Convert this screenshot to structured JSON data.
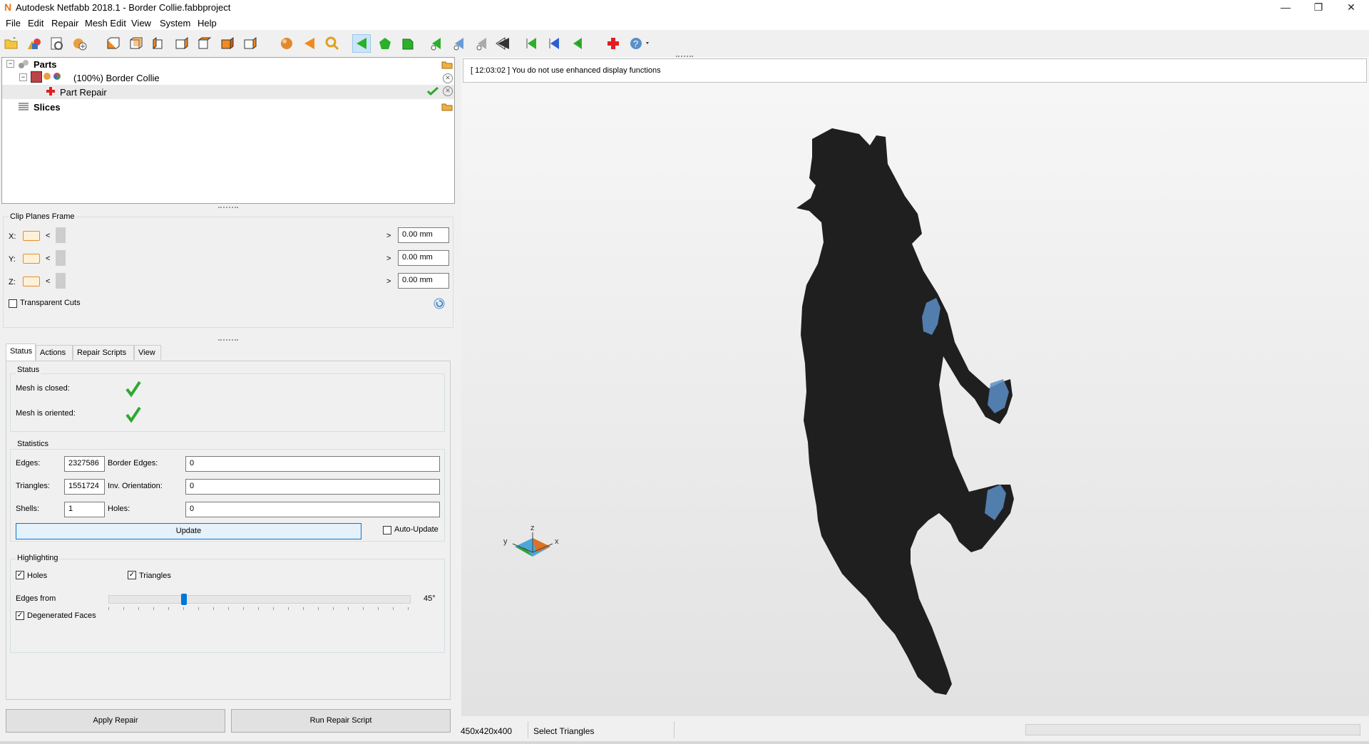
{
  "window": {
    "title": "Autodesk Netfabb 2018.1 - Border Collie.fabbproject",
    "minimize_glyph": "—",
    "restore_glyph": "❐",
    "close_glyph": "✕"
  },
  "menu": [
    "File",
    "Edit",
    "Repair",
    "Mesh Edit",
    "View",
    "System",
    "Help"
  ],
  "toolbar_icons": [
    "open-folder-icon",
    "add-part-icon",
    "import-icon",
    "new-part-icon",
    "view-front-icon",
    "view-back-icon",
    "view-left-icon",
    "view-right-icon",
    "view-top-icon",
    "view-bottom-icon",
    "view-iso-icon",
    "sphere-icon",
    "arrow-back-icon",
    "zoom-icon",
    "select-triangle-icon",
    "select-surface-icon",
    "select-shell-icon",
    "tri-add-icon",
    "tri-blue-icon",
    "tri-grey-icon",
    "tri-dark-icon",
    "mark-green-icon",
    "mark-blue-icon",
    "mark-green-2-icon",
    "repair-cross-icon",
    "help-icon"
  ],
  "tree": {
    "parts_label": "Parts",
    "part_name": "(100%) Border Collie",
    "repair_label": "Part Repair",
    "slices_label": "Slices"
  },
  "clip": {
    "title": "Clip Planes Frame",
    "rows": [
      {
        "axis": "X:",
        "value": "0.00 mm"
      },
      {
        "axis": "Y:",
        "value": "0.00 mm"
      },
      {
        "axis": "Z:",
        "value": "0.00 mm"
      }
    ],
    "transparent_label": "Transparent Cuts",
    "left_arrow": "<",
    "right_arrow": ">"
  },
  "tabs": [
    "Status",
    "Actions",
    "Repair Scripts",
    "View"
  ],
  "status": {
    "title": "Status",
    "closed_label": "Mesh is closed:",
    "oriented_label": "Mesh is oriented:"
  },
  "statistics": {
    "title": "Statistics",
    "edges_label": "Edges:",
    "edges_value": "2327586",
    "border_edges_label": "Border Edges:",
    "border_edges_value": "0",
    "triangles_label": "Triangles:",
    "triangles_value": "1551724",
    "inv_orientation_label": "Inv. Orientation:",
    "inv_orientation_value": "0",
    "shells_label": "Shells:",
    "shells_value": "1",
    "holes_label": "Holes:",
    "holes_value": "0",
    "update_label": "Update",
    "auto_update_label": "Auto-Update"
  },
  "highlighting": {
    "title": "Highlighting",
    "holes_label": "Holes",
    "triangles_label": "Triangles",
    "edges_from_label": "Edges from",
    "edges_from_value": "45°",
    "degenerated_label": "Degenerated Faces",
    "slider_fraction": 0.25
  },
  "buttons": {
    "apply_repair": "Apply Repair",
    "run_repair_script": "Run Repair Script"
  },
  "log": {
    "message": "[ 12:03:02 ] You do not use enhanced display functions"
  },
  "axes": {
    "x": "x",
    "y": "y",
    "z": "z"
  },
  "statusbar": {
    "dimensions": "450x420x400",
    "mode": "Select Triangles"
  },
  "colors": {
    "accent": "#0078d7",
    "selection_blue": "#5b8fc7",
    "check_green": "#2fa82f",
    "model": "#1f1f1f"
  }
}
